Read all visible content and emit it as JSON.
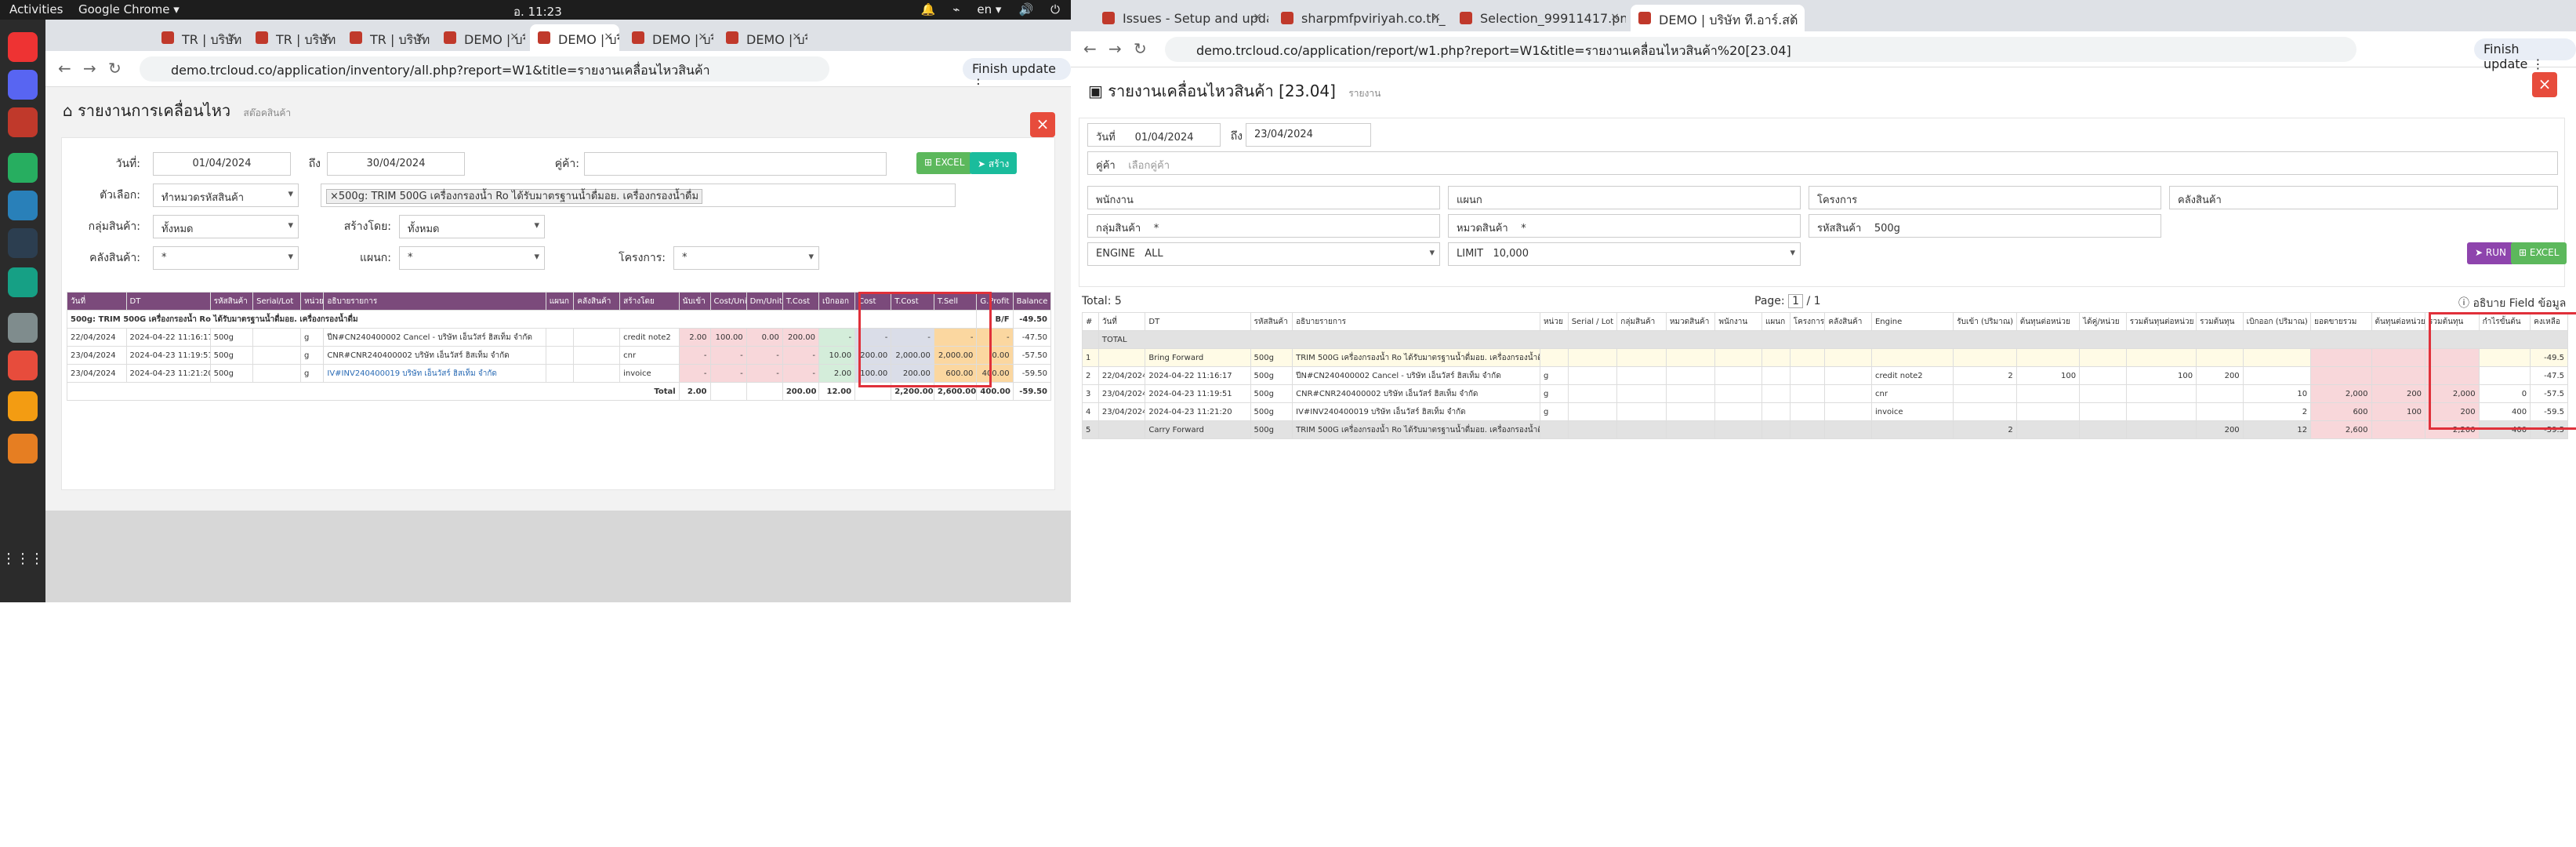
{
  "system": {
    "activities": "Activities",
    "app": "Google Chrome ▾",
    "clock": "อ. 11:23",
    "lang": "en ▾",
    "tray": [
      "🔔",
      "⌁",
      "🔊",
      "⏻"
    ]
  },
  "dock": [
    {
      "icon": "chrome-icon",
      "color": "#e33"
    },
    {
      "icon": "discord-icon",
      "color": "#5865f2"
    },
    {
      "icon": "files-icon",
      "color": "#c0392b"
    },
    {
      "icon": "sheets-icon",
      "color": "#27ae60"
    },
    {
      "icon": "docs-icon",
      "color": "#2980b9"
    },
    {
      "icon": "app-icon",
      "color": "#2c3e50"
    },
    {
      "icon": "globe-icon",
      "color": "#16a085"
    },
    {
      "icon": "calc-icon",
      "color": "#7f8c8d"
    },
    {
      "icon": "anydesk-icon",
      "color": "#e74c3c"
    },
    {
      "icon": "notes-icon",
      "color": "#f39c12"
    },
    {
      "icon": "postman-icon",
      "color": "#e67e22"
    },
    {
      "icon": "apps-grid-icon",
      "color": "transparent"
    }
  ],
  "w1": {
    "tabs": [
      "TR | บริษัท ที",
      "TR | บริษัท ที",
      "TR | บริษัท ที",
      "DEMO | บริ",
      "DEMO | บริ",
      "DEMO | บริ",
      "DEMO | บริ"
    ],
    "url": "demo.trcloud.co/application/inventory/all.php?report=W1&title=รายงานเคลื่อนไหวสินค้า",
    "finish": "Finish update ⋮",
    "title": "รายงานการเคลื่อนไหว",
    "subtitle": "สต๊อคสินค้า",
    "f": {
      "date_label": "วันที่:",
      "date_from": "01/04/2024",
      "to": "ถึง",
      "date_to": "30/04/2024",
      "party_label": "คู่ค้า:",
      "party": "",
      "choose_label": "ตัวเลือก:",
      "choose": "ทำหมวดรหัสสินค้า",
      "product_tag": "×500g: TRIM 500G เครื่องกรองน้ำ Ro ได้รับมาตรฐานน้ำดื่มอย. เครื่องกรองน้ำดื่ม",
      "group_label": "กลุ่มสินค้า:",
      "group": "ทั้งหมด",
      "created_label": "สร้างโดย:",
      "created": "ทั้งหมด",
      "wh_label": "คลังสินค้า:",
      "wh": "*",
      "dept_label": "แผนก:",
      "dept": "*",
      "proj_label": "โครงการ:",
      "proj": "*",
      "excel": "⊞ EXCEL",
      "run": "➤ สร้าง"
    },
    "headers": [
      "วันที่",
      "DT",
      "รหัสสินค้า",
      "Serial/Lot",
      "หน่วย",
      "อธิบายรายการ",
      "แผนก",
      "คลังสินค้า",
      "สร้างโดย",
      "นับเข้า",
      "Cost/Unit",
      "Dm/Unit",
      "T.Cost",
      "เบิกออก",
      "Cost",
      "T.Cost",
      "T.Sell",
      "G.Profit",
      "Balance"
    ],
    "rows": [
      [
        "500g: TRIM 500G เครื่องกรองน้ำ Ro ได้รับมาตรฐานน้ำดื่มอย. เครื่องกรองน้ำดื่ม",
        "B/F",
        "-49.50"
      ],
      [
        "22/04/2024",
        "2024-04-22 11:16:17",
        "500g",
        "",
        "g",
        "ปีN#CN240400002 Cancel - บริษัท เอ็นวัสร์ ฮิสเท็ม จำกัด",
        "",
        "",
        "credit note2",
        "2.00",
        "100.00",
        "0.00",
        "200.00",
        "-",
        "-",
        "-",
        "-",
        "-",
        "-47.50"
      ],
      [
        "23/04/2024",
        "2024-04-23 11:19:51",
        "500g",
        "",
        "g",
        "CNR#CNR240400002 บริษัท เอ็นวัสร์ ฮิสเท็ม จำกัด",
        "",
        "",
        "cnr",
        "-",
        "-",
        "-",
        "-",
        "10.00",
        "200.00",
        "2,000.00",
        "2,000.00",
        "0.00",
        "-57.50"
      ],
      [
        "23/04/2024",
        "2024-04-23 11:21:20",
        "500g",
        "",
        "g",
        "IV#INV240400019 บริษัท เอ็นวัสร์ ฮิสเท็ม จำกัด",
        "",
        "",
        "invoice",
        "-",
        "-",
        "-",
        "-",
        "2.00",
        "100.00",
        "200.00",
        "600.00",
        "400.00",
        "-59.50"
      ]
    ],
    "total": [
      "Total",
      "2.00",
      "",
      "",
      "200.00",
      "12.00",
      "",
      "2,200.00",
      "2,600.00",
      "400.00",
      "-59.50"
    ]
  },
  "w2": {
    "tabs": [
      "Issues - Setup and updat",
      "sharpmfpviriyah.co.th_",
      "Selection_99911417.png",
      "DEMO | บริษัท ที.อาร์.สต"
    ],
    "url": "demo.trcloud.co/application/report/w1.php?report=W1&title=รายงานเคลื่อนไหวสินค้า%20[23.04]",
    "finish": "Finish update ⋮",
    "title": "รายงานเคลื่อนไหวสินค้า [23.04]",
    "subtitle": "รายงาน",
    "f": {
      "date_label": "วันที่",
      "date_from": "01/04/2024",
      "to": "ถึง",
      "date_to": "23/04/2024",
      "party_label": "คู่ค้า",
      "party_ph": "เลือกคู่ค้า",
      "emp_label": "พนักงาน",
      "dept_label": "แผนก",
      "proj_label": "โครงการ",
      "wh_label": "คลังสินค้า",
      "grp_label": "กลุ่มสินค้า",
      "grp": "*",
      "cat_label": "หมวดสินค้า",
      "cat": "*",
      "code_label": "รหัสสินค้า",
      "code": "500g",
      "engine_label": "ENGINE",
      "engine": "ALL",
      "limit_label": "LIMIT",
      "limit": "10,000",
      "run": "➤ RUN",
      "excel": "⊞ EXCEL"
    },
    "total_label": "Total: 5",
    "page": "Page:",
    "page_num": "1",
    "page_of": "/ 1",
    "field_info": "ⓘ อธิบาย Field ข้อมูล",
    "headers": [
      "#",
      "วันที่",
      "DT",
      "รหัสสินค้า",
      "อธิบายรายการ",
      "หน่วย",
      "Serial / Lot",
      "กลุ่มสินค้า",
      "หมวดสินค้า",
      "พนักงาน",
      "แผนก",
      "โครงการ",
      "คลังสินค้า",
      "Engine",
      "รับเข้า (ปริมาณ)",
      "ต้นทุนต่อหน่วย",
      "ได้คู่/หน่วย",
      "รวมต้นทุนต่อหน่วย",
      "รวมต้นทุน",
      "เบิกออก (ปริมาณ)",
      "ยอดขายรวม",
      "ต้นทุนต่อหน่วย",
      "รวมต้นทุน",
      "กำไรขั้นต้น",
      "คงเหลือ"
    ],
    "rows": [
      [
        "",
        "TOTAL"
      ],
      [
        "1",
        "",
        "Bring Forward",
        "500g",
        "TRIM 500G เครื่องกรองน้ำ Ro ได้รับมาตรฐานน้ำดื่มอย. เครื่องกรองน้ำดื่ม",
        "",
        "",
        "",
        "",
        "",
        "",
        "",
        "",
        "",
        "",
        "",
        "",
        "",
        "",
        "",
        "",
        "",
        "",
        "",
        "-49.5"
      ],
      [
        "2",
        "22/04/2024",
        "2024-04-22 11:16:17",
        "500g",
        "ปีN#CN240400002 Cancel - บริษัท เอ็นวัสร์ ฮิสเท็ม จำกัด",
        "g",
        "",
        "",
        "",
        "",
        "",
        "",
        "",
        "credit note2",
        "2",
        "100",
        "",
        "100",
        "200",
        "",
        "",
        "",
        "",
        "",
        "-47.5"
      ],
      [
        "3",
        "23/04/2024",
        "2024-04-23 11:19:51",
        "500g",
        "CNR#CNR240400002 บริษัท เอ็นวัสร์ ฮิสเท็ม จำกัด",
        "g",
        "",
        "",
        "",
        "",
        "",
        "",
        "",
        "cnr",
        "",
        "",
        "",
        "",
        "",
        "10",
        "2,000",
        "200",
        "2,000",
        "0",
        "-57.5"
      ],
      [
        "4",
        "23/04/2024",
        "2024-04-23 11:21:20",
        "500g",
        "IV#INV240400019 บริษัท เอ็นวัสร์ ฮิสเท็ม จำกัด",
        "g",
        "",
        "",
        "",
        "",
        "",
        "",
        "",
        "invoice",
        "",
        "",
        "",
        "",
        "",
        "2",
        "600",
        "100",
        "200",
        "400",
        "-59.5"
      ],
      [
        "5",
        "",
        "Carry Forward",
        "500g",
        "TRIM 500G เครื่องกรองน้ำ Ro ได้รับมาตรฐานน้ำดื่มอย. เครื่องกรองน้ำดื่ม",
        "",
        "",
        "",
        "",
        "",
        "",
        "",
        "",
        "",
        "2",
        "",
        "",
        "",
        "200",
        "12",
        "2,600",
        "",
        "2,200",
        "400",
        "-59.5"
      ]
    ]
  }
}
